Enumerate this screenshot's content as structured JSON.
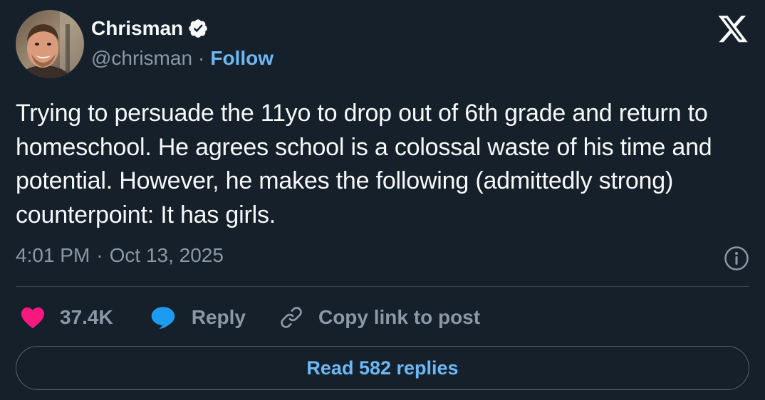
{
  "author": {
    "display_name": "Chrisman",
    "handle": "@chrisman",
    "separator": "·",
    "follow_label": "Follow",
    "verified": true
  },
  "tweet": {
    "text": "Trying to persuade the 11yo to drop out of 6th grade and return to homeschool. He agrees school is a colossal waste of his time and potential. However, he makes the following (admittedly strong) counterpoint: It has girls.",
    "time": "4:01 PM",
    "separator": "·",
    "date": "Oct 13, 2025"
  },
  "actions": {
    "like_count": "37.4K",
    "reply_label": "Reply",
    "copy_link_label": "Copy link to post"
  },
  "footer": {
    "read_replies_label": "Read 582 replies"
  },
  "icons": {
    "brand": "x-logo-icon",
    "verified": "verified-badge-icon",
    "info": "info-icon",
    "like": "heart-icon",
    "reply": "speech-bubble-icon",
    "copy": "link-icon"
  },
  "colors": {
    "background": "#15202b",
    "text": "#f7f9f9",
    "muted": "#8b98a5",
    "accent": "#6cb8f5",
    "like": "#f91880",
    "reply": "#1d9bf0",
    "divider": "#38444d"
  }
}
